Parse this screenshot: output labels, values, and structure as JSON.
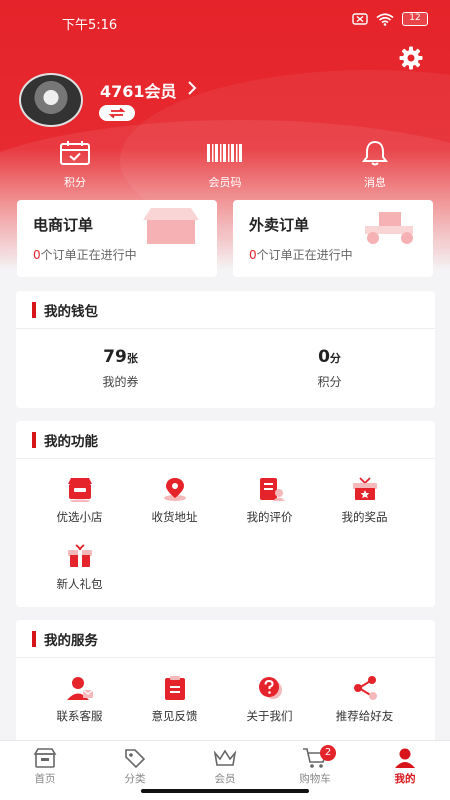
{
  "status_bar": {
    "time": "下午5:16",
    "battery": "12"
  },
  "profile": {
    "name": "4761会员"
  },
  "quick_actions": [
    {
      "label": "积分",
      "icon": "calendar-check-icon"
    },
    {
      "label": "会员码",
      "icon": "barcode-icon"
    },
    {
      "label": "消息",
      "icon": "bell-icon"
    }
  ],
  "orders": [
    {
      "title": "电商订单",
      "count": "0",
      "suffix": "个订单正在进行中"
    },
    {
      "title": "外卖订单",
      "count": "0",
      "suffix": "个订单正在进行中"
    }
  ],
  "wallet": {
    "title": "我的钱包",
    "items": [
      {
        "value": "79",
        "unit": "张",
        "label": "我的券"
      },
      {
        "value": "0",
        "unit": "分",
        "label": "积分"
      }
    ]
  },
  "functions": {
    "title": "我的功能",
    "items": [
      {
        "label": "优选小店",
        "icon": "store-icon"
      },
      {
        "label": "收货地址",
        "icon": "location-pin-icon"
      },
      {
        "label": "我的评价",
        "icon": "review-icon"
      },
      {
        "label": "我的奖品",
        "icon": "prize-box-icon"
      },
      {
        "label": "新人礼包",
        "icon": "gift-icon"
      }
    ]
  },
  "services": {
    "title": "我的服务",
    "items": [
      {
        "label": "联系客服",
        "icon": "customer-service-icon"
      },
      {
        "label": "意见反馈",
        "icon": "feedback-clipboard-icon"
      },
      {
        "label": "关于我们",
        "icon": "question-icon"
      },
      {
        "label": "推荐给好友",
        "icon": "share-icon"
      }
    ]
  },
  "tabbar": {
    "items": [
      {
        "label": "首页",
        "icon": "home-store-icon"
      },
      {
        "label": "分类",
        "icon": "tag-icon"
      },
      {
        "label": "会员",
        "icon": "crown-icon"
      },
      {
        "label": "购物车",
        "icon": "cart-icon",
        "badge": "2"
      },
      {
        "label": "我的",
        "icon": "user-icon",
        "active": true
      }
    ]
  },
  "colors": {
    "brand": "#e5232a",
    "accent_bar": "#d7141a",
    "background": "#f4f4f6"
  }
}
